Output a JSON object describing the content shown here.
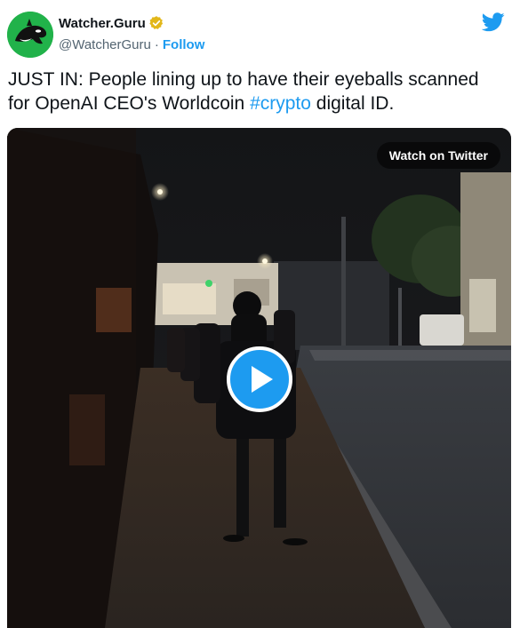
{
  "author": {
    "display_name": "Watcher.Guru",
    "handle": "@WatcherGuru",
    "separator": "·",
    "follow_label": "Follow",
    "verified_color": "#e2b719",
    "avatar_color": "#21b24a"
  },
  "tweet": {
    "text_before": "JUST IN: People lining up to have their eyeballs scanned for OpenAI CEO's Worldcoin ",
    "hashtag": "#crypto",
    "text_after": " digital ID."
  },
  "media": {
    "watch_label": "Watch on Twitter",
    "play_color": "#1d9bf0"
  },
  "icons": {
    "brand": "twitter-bird-icon",
    "verified": "verified-badge-icon",
    "play": "play-icon"
  }
}
